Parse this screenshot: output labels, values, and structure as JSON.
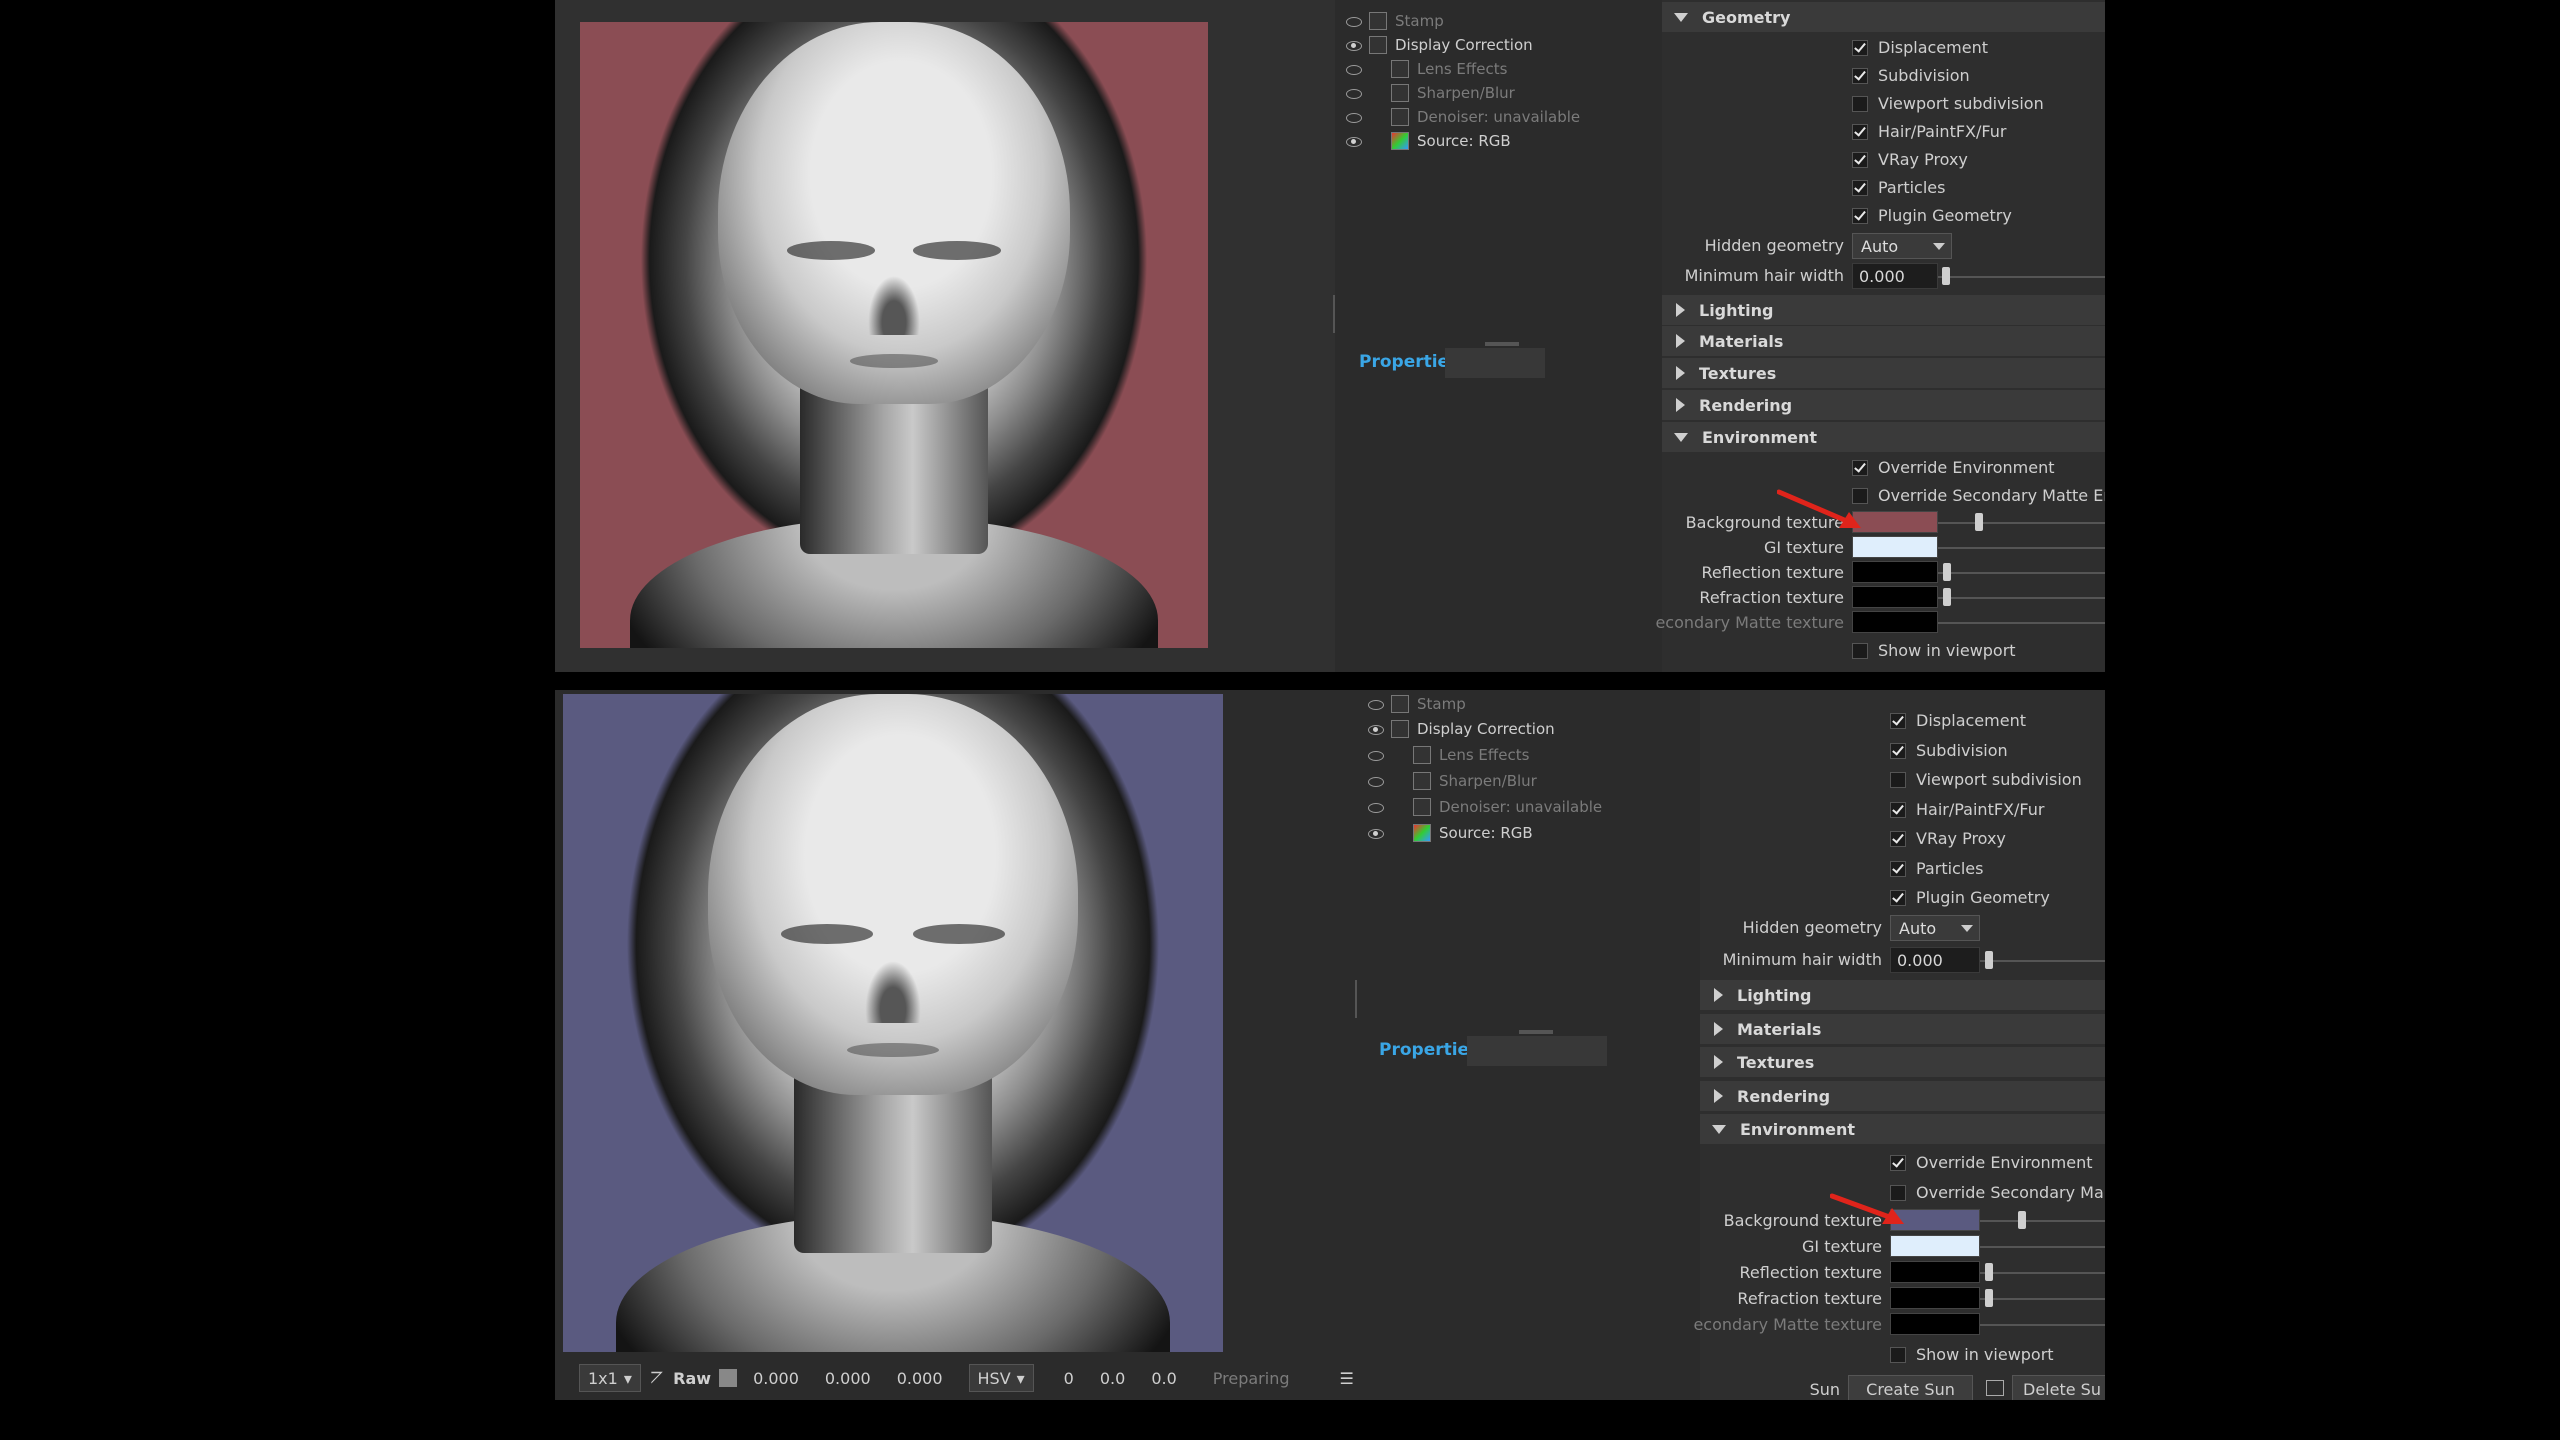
{
  "layers": {
    "items": [
      {
        "label": "Stamp",
        "visible": false,
        "dim": true
      },
      {
        "label": "Display Correction",
        "visible": true,
        "dim": false
      },
      {
        "label": "Lens Effects",
        "visible": false,
        "dim": true
      },
      {
        "label": "Sharpen/Blur",
        "visible": false,
        "dim": true
      },
      {
        "label": "Denoiser: unavailable",
        "visible": false,
        "dim": true
      },
      {
        "label": "Source: RGB",
        "visible": true,
        "dim": false
      }
    ]
  },
  "properties_title": "Properties",
  "geometry": {
    "title": "Geometry",
    "checks": [
      {
        "label": "Displacement",
        "checked": true
      },
      {
        "label": "Subdivision",
        "checked": true
      },
      {
        "label": "Viewport subdivision",
        "checked": false
      },
      {
        "label": "Hair/PaintFX/Fur",
        "checked": true
      },
      {
        "label": "VRay Proxy",
        "checked": true
      },
      {
        "label": "Particles",
        "checked": true
      },
      {
        "label": "Plugin Geometry",
        "checked": true
      }
    ],
    "hidden_geometry_label": "Hidden geometry",
    "hidden_geometry_value": "Auto",
    "min_hair_label": "Minimum hair width",
    "min_hair_value": "0.000"
  },
  "sections": [
    "Lighting",
    "Materials",
    "Textures",
    "Rendering"
  ],
  "environment": {
    "title": "Environment",
    "override_env": "Override Environment",
    "override_secondary_top": "Override Secondary Matte Envir",
    "override_secondary_bottom": "Override Secondary Ma",
    "bg_texture": "Background texture",
    "gi_texture": "GI texture",
    "reflection_texture": "Reflection texture",
    "refraction_texture": "Refraction texture",
    "secondary_matte_texture": "econdary Matte texture",
    "show_in_viewport": "Show in viewport"
  },
  "colors": {
    "bg_top": "#8b4d54",
    "bg_bottom": "#5a5a80",
    "gi_swatch": "#dfeefc",
    "arrow": "#e0241b"
  },
  "statusbar": {
    "res": "1x1",
    "mode": "Raw",
    "r": "0.000",
    "g": "0.000",
    "b": "0.000",
    "space": "HSV",
    "h": "0",
    "s": "0.0",
    "v": "0.0",
    "status": "Preparing"
  },
  "sun": {
    "label": "Sun",
    "create": "Create Sun",
    "delete": "Delete Su"
  }
}
